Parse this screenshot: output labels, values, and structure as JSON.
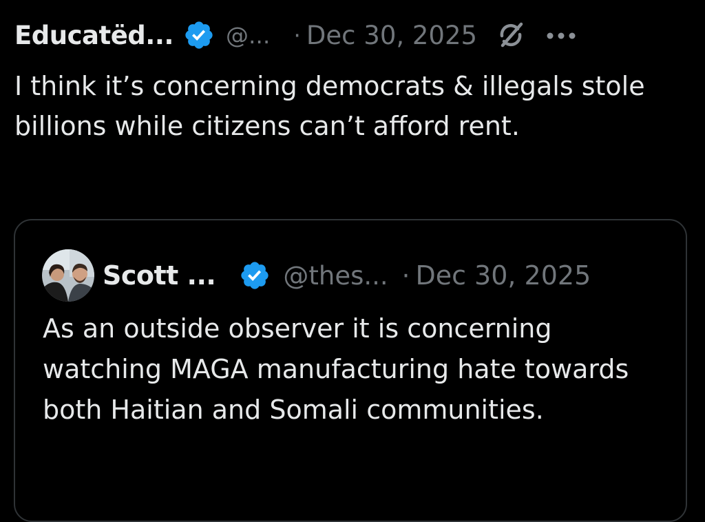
{
  "tweet": {
    "author_name": "Educatëd...",
    "handle": "@...",
    "separator": "·",
    "date": "Dec 30, 2025",
    "text": "I think it’s concerning democrats & illegals stole billions while citizens can’t afford rent.",
    "icons": {
      "verified": "verified-badge-icon",
      "grok": "grok-icon",
      "more": "more-options-icon"
    }
  },
  "quoted_tweet": {
    "author_name": "Scott ...",
    "handle": "@thes...",
    "separator": "·",
    "date": "Dec 30, 2025",
    "text": "As an outside observer it is concerning watching MAGA manufacturing hate towards both Haitian and Somali communities.",
    "icons": {
      "verified": "verified-badge-icon",
      "avatar": "avatar-image"
    }
  },
  "colors": {
    "background": "#000000",
    "primary_text": "#e7e9ea",
    "secondary_text": "#71767b",
    "verified_blue": "#1d9bf0",
    "border": "#2f3336"
  }
}
